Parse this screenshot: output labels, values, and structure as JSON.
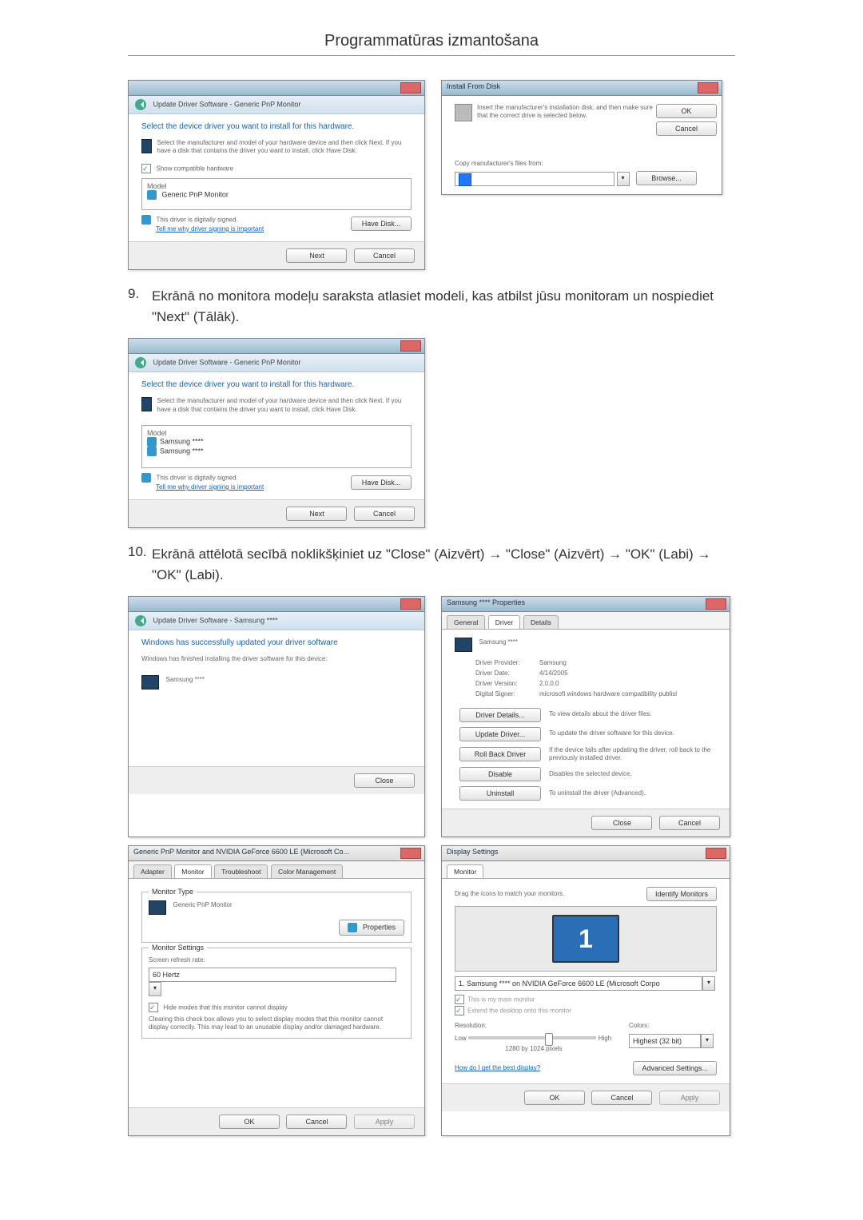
{
  "page_title": "Programmatūras izmantošana",
  "shot_a": {
    "subbar": "Update Driver Software - Generic PnP Monitor",
    "headline": "Select the device driver you want to install for this hardware.",
    "subline": "Select the manufacturer and model of your hardware device and then click Next. If you have a disk that contains the driver you want to install, click Have Disk.",
    "check_label": "Show compatible hardware",
    "col_model": "Model",
    "row1": "Generic PnP Monitor",
    "signed": "This driver is digitally signed.",
    "signed_link": "Tell me why driver signing is important",
    "have_disk": "Have Disk...",
    "next": "Next",
    "cancel": "Cancel"
  },
  "shot_b": {
    "title": "Install From Disk",
    "msg": "Insert the manufacturer's installation disk, and then make sure that the correct drive is selected below.",
    "ok": "OK",
    "cancel": "Cancel",
    "copy_label": "Copy manufacturer's files from:",
    "browse": "Browse..."
  },
  "step9": {
    "num": "9.",
    "text": "Ekrānā no monitora modeļu saraksta atlasiet modeli, kas atbilst jūsu monitoram un nospiediet \"Next\" (Tālāk)."
  },
  "shot_c": {
    "subbar": "Update Driver Software - Generic PnP Monitor",
    "headline": "Select the device driver you want to install for this hardware.",
    "subline": "Select the manufacturer and model of your hardware device and then click Next. If you have a disk that contains the driver you want to install, click Have Disk.",
    "col_model": "Model",
    "row1": "Samsung ****",
    "row2": "Samsung ****",
    "signed": "This driver is digitally signed.",
    "signed_link": "Tell me why driver signing is important",
    "have_disk": "Have Disk...",
    "next": "Next",
    "cancel": "Cancel"
  },
  "step10": {
    "num": "10.",
    "text": "Ekrānā attēlotā secībā noklikšķiniet uz \"Close\" (Aizvērt) → \"Close\" (Aizvērt) → \"OK\" (Labi) → \"OK\" (Labi)."
  },
  "shot_d": {
    "subbar": "Update Driver Software - Samsung ****",
    "headline": "Windows has successfully updated your driver software",
    "subline": "Windows has finished installing the driver software for this device:",
    "device": "Samsung ****",
    "close": "Close"
  },
  "shot_e": {
    "title": "Samsung **** Properties",
    "tab_general": "General",
    "tab_driver": "Driver",
    "tab_details": "Details",
    "device": "Samsung ****",
    "lbl_provider": "Driver Provider:",
    "val_provider": "Samsung",
    "lbl_date": "Driver Date:",
    "val_date": "4/14/2005",
    "lbl_version": "Driver Version:",
    "val_version": "2.0.0.0",
    "lbl_signer": "Digital Signer:",
    "val_signer": "microsoft windows hardware compatibility publisl",
    "btn_details": "Driver Details...",
    "txt_details": "To view details about the driver files.",
    "btn_update": "Update Driver...",
    "txt_update": "To update the driver software for this device.",
    "btn_rollback": "Roll Back Driver",
    "txt_rollback": "If the device fails after updating the driver, roll back to the previously installed driver.",
    "btn_disable": "Disable",
    "txt_disable": "Disables the selected device.",
    "btn_uninstall": "Uninstall",
    "txt_uninstall": "To uninstall the driver (Advanced).",
    "close": "Close",
    "cancel": "Cancel"
  },
  "shot_f": {
    "title": "Generic PnP Monitor and NVIDIA GeForce 6600 LE (Microsoft Co...",
    "tab_adapter": "Adapter",
    "tab_monitor": "Monitor",
    "tab_trouble": "Troubleshoot",
    "tab_color": "Color Management",
    "legend_type": "Monitor Type",
    "monitor_name": "Generic PnP Monitor",
    "btn_props": "Properties",
    "legend_settings": "Monitor Settings",
    "lbl_refresh": "Screen refresh rate:",
    "val_refresh": "60 Hertz",
    "chk_hide": "Hide modes that this monitor cannot display",
    "hide_desc": "Clearing this check box allows you to select display modes that this monitor cannot display correctly. This may lead to an unusable display and/or damaged hardware.",
    "ok": "OK",
    "cancel": "Cancel",
    "apply": "Apply"
  },
  "shot_g": {
    "title": "Display Settings",
    "tab_monitor": "Monitor",
    "drag_msg": "Drag the icons to match your monitors.",
    "btn_identify": "Identify Monitors",
    "mon_number": "1",
    "dd_value": "1. Samsung **** on NVIDIA GeForce 6600 LE (Microsoft Corpo",
    "chk_main": "This is my main monitor",
    "chk_extend": "Extend the desktop onto this monitor",
    "lbl_res": "Resolution:",
    "lbl_low": "Low",
    "lbl_high": "High",
    "res_value": "1280 by 1024 pixels",
    "lbl_colors": "Colors:",
    "val_colors": "Highest (32 bit)",
    "link_best": "How do I get the best display?",
    "btn_adv": "Advanced Settings...",
    "ok": "OK",
    "cancel": "Cancel",
    "apply": "Apply"
  }
}
